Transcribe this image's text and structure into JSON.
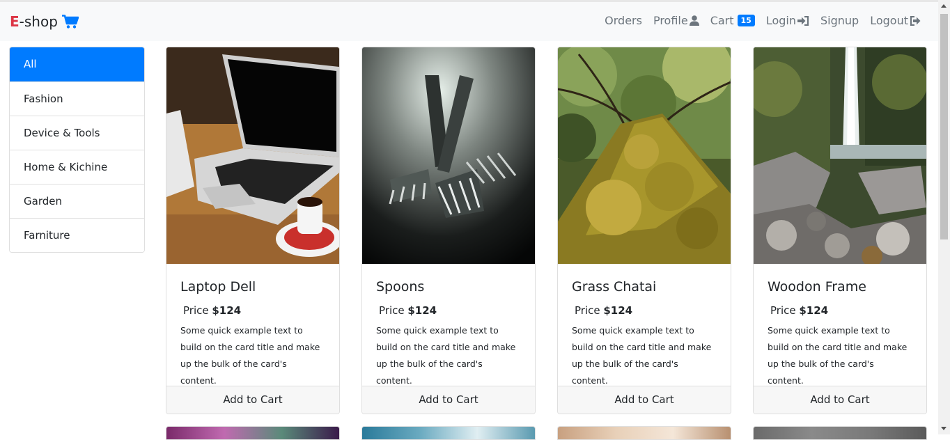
{
  "navbar": {
    "brand_e": "E",
    "brand_rest": "-shop",
    "links": {
      "orders": "Orders",
      "profile": "Profile",
      "cart": "Cart",
      "cart_count": "15",
      "login": "Login",
      "signup": "Signup",
      "logout": "Logout"
    },
    "icons": {
      "brand": "shopping-cart-icon",
      "profile": "user-icon",
      "login": "sign-in-icon",
      "logout": "sign-out-icon"
    }
  },
  "colors": {
    "accent": "#007bff",
    "brand_e": "#dc3545",
    "navbar_bg": "#f8f9fa"
  },
  "sidebar": {
    "categories": [
      {
        "label": "All",
        "active": true
      },
      {
        "label": "Fashion"
      },
      {
        "label": "Device & Tools"
      },
      {
        "label": "Home & Kichine"
      },
      {
        "label": "Garden"
      },
      {
        "label": "Farniture"
      }
    ]
  },
  "products": [
    {
      "title": "Laptop Dell",
      "price_label": "Price",
      "price": "$124",
      "description": "Some quick example text to build on the card title and make up the bulk of the card's content.",
      "button": "Add to Cart"
    },
    {
      "title": "Spoons",
      "price_label": "Price",
      "price": "$124",
      "description": "Some quick example text to build on the card title and make up the bulk of the card's content.",
      "button": "Add to Cart"
    },
    {
      "title": "Grass Chatai",
      "price_label": "Price",
      "price": "$124",
      "description": "Some quick example text to build on the card title and make up the bulk of the card's content.",
      "button": "Add to Cart"
    },
    {
      "title": "Woodon Frame",
      "price_label": "Price",
      "price": "$124",
      "description": "Some quick example text to build on the card title and make up the bulk of the card's content.",
      "button": "Add to Cart"
    }
  ]
}
